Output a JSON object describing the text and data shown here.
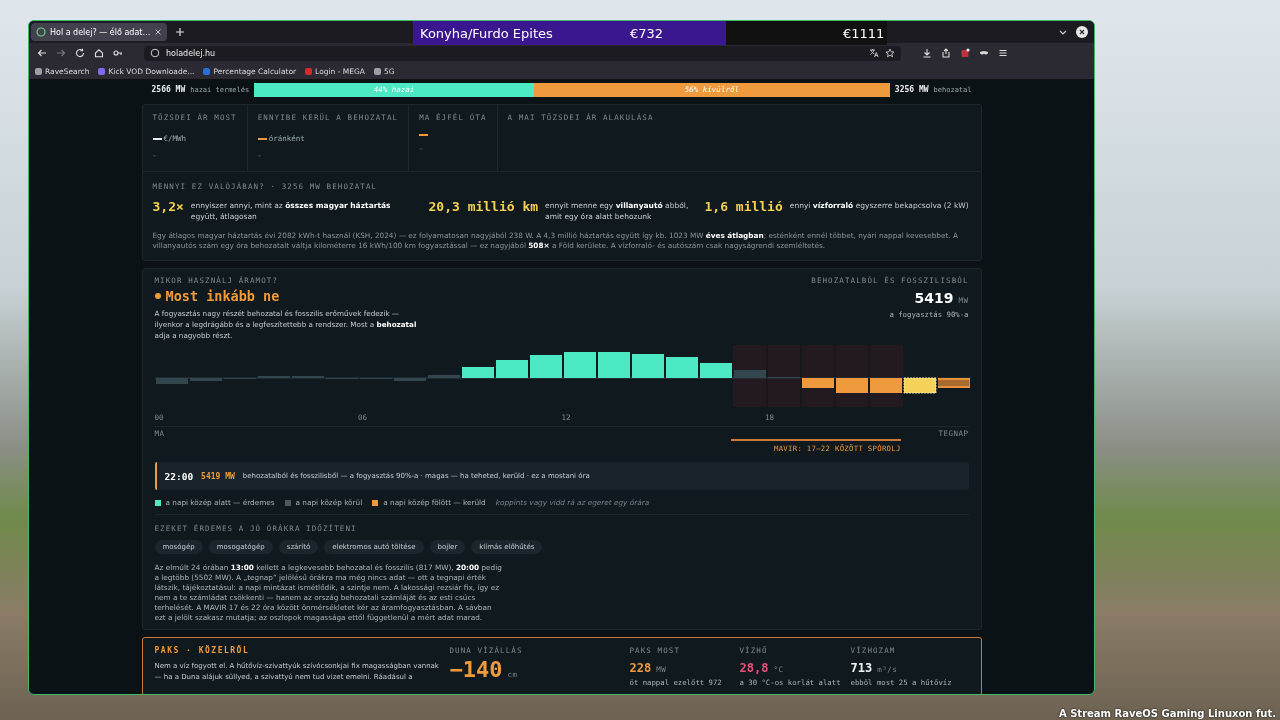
{
  "desktop": {
    "stream_ticker": "A Stream RaveOS Gaming Linuxon fut."
  },
  "goal_overlay": {
    "title": "Konyha/Furdo Epites",
    "current": "€732",
    "target": "€1111",
    "level": 0.66
  },
  "browser": {
    "tabs": [
      {
        "title": "Hol a delej? — élő adat…",
        "selected": true
      }
    ],
    "address": "holadelej.hu",
    "bookmarks": [
      {
        "label": "RaveSearch",
        "color": "#9aa0a6"
      },
      {
        "label": "Kick VOD Downloade...",
        "color": "#7b6cf0"
      },
      {
        "label": "Percentage Calculator",
        "color": "#2b6fd6"
      },
      {
        "label": "Login - MEGA",
        "color": "#d9272e"
      },
      {
        "label": "5G",
        "color": "#9aa0a6"
      }
    ]
  },
  "supply_bar": {
    "domestic_value": "2566 MW",
    "domestic_label": "hazai termelés",
    "domestic_share": "44% hazai",
    "import_share": "56% kívülről",
    "import_value": "3256 MW",
    "import_label": "behozatal",
    "level": 0.44
  },
  "prices": {
    "columns": [
      {
        "label": "TŐZSDEI ÁR MOST",
        "color": "#e8ecee",
        "unit": "€/MWh",
        "value": "–"
      },
      {
        "label": "ENNYIBE KERÜL A BEHOZATAL",
        "color": "#f09a3e",
        "unit": "óránként",
        "value": "–"
      },
      {
        "label": "MA ÉJFÉL ÓTA",
        "color": "#f09a3e",
        "value": "–"
      }
    ],
    "chart_title": "A MAI TŐZSDEI ÁR ALAKULÁSA"
  },
  "equivalents": {
    "title": "MENNYI EZ VALÓJÁBAN? · 3256 MW BEHOZATAL",
    "items": [
      {
        "value": "3,2×",
        "text": "ennyiszer annyi, mint az **összes magyar háztartás** együtt, átlagosan"
      },
      {
        "value": "20,3 millió km",
        "text": "ennyit menne egy **villanyautó** abból, amit egy óra alatt behozunk"
      },
      {
        "value": "1,6 millió",
        "text": "ennyi **vízforraló** egyszerre bekapcsolva (2 kW)"
      }
    ],
    "note": "Egy átlagos magyar háztartás évi 2082 kWh-t használ (KSH, 2024) — ez folyamatosan nagyjából 238 W. A 4,3 millió háztartás együtt így kb. 1023 MW **éves átlagban**; esténként ennél többet, nyári nappal kevesebbet. A villanyautós szám egy óra behozatalt váltja kilométerre 16 kWh/100 km fogyasztással — ez nagyjából **508×** a Föld kerülete. A vízforraló- és autószám csak nagyságrendi szemléltetés."
  },
  "timing": {
    "title": "MIKOR HASZNÁLJ ÁRAMOT?",
    "status": "Most inkább ne",
    "description": "A fogyasztás nagy részét behozatal és fosszilis erőművek fedezik — ilyenkor a legdrágább és a legfeszítettebb a rendszer. Most a **behozatal** adja a nagyobb részt.",
    "side_label": "BEHOZATALBÓL ÉS FOSSZILISBÓL",
    "side_value": "5419",
    "side_unit": "MW",
    "side_note": "a fogyasztás 90%-a",
    "hour_labels": [
      "00",
      "06",
      "12",
      "18"
    ],
    "today_label": "MA",
    "yesterday_label": "TEGNAP",
    "band_label": "MAVIR: 17–22 KÖZÖTT SPÓROLJ",
    "info": {
      "time": "22:00",
      "value": "5419 MW",
      "text": "behozatalból és fosszilisből — a fogyasztás 90%-a · magas — ha teheted, kerüld · ez a mostani óra"
    },
    "legend": [
      {
        "label": "a napi közép alatt — érdemes",
        "color": "#4de8c4"
      },
      {
        "label": "a napi közép körül",
        "color": "#4a5a62"
      },
      {
        "label": "a napi közép fölött — kerüld",
        "color": "#f09a3e"
      }
    ],
    "hint": "koppints vagy vidd rá az egeret egy órára",
    "appliances_title": "EZEKET ÉRDEMES A JÓ ÓRÁKRA IDŐZÍTENI",
    "appliances": [
      "mosógép",
      "mosogatógép",
      "szárító",
      "elektromos autó töltése",
      "bojler",
      "klímás előhűtés"
    ],
    "summary": "Az elmúlt 24 órában **13:00** kellett a legkevesebb behozatal és fosszilis (817 MW), **20:00** pedig a legtöbb (5502 MW). A „tegnap” jelölésű órákra ma még nincs adat — ott a tegnapi érték látszik, tájékoztatásul: a napi mintázat ismétlődik, a szintje nem. A lakossági rezsiár fix, így ez nem a te számládat csökkenti — hanem az ország behozatali számláját és az esti csúcs terhelését. A MAVIR 17 és 22 óra között önmérsékletet kér az áramfogyasztásban. A sávban ezt a jelölt szakasz mutatja; az oszlopok magassága ettől függetlenül a mért adat marad."
  },
  "paks": {
    "title": "PAKS · KÖZELRŐL",
    "text": "Nem a víz fogyott el. A hűtővíz-szivattyúk szívócsonkjai fix magasságban vannak — ha a Duna alájuk süllyed, a szivattyú nem tud vizet emelni. Ráadásul a",
    "level_label": "DUNA VÍZÁLLÁS",
    "level_value": "−140",
    "level_unit": "cm",
    "stats": [
      {
        "label": "PAKS MOST",
        "value": "228",
        "unit": "MW",
        "note": "öt nappal ezelőtt 972",
        "color": "#f09a3e"
      },
      {
        "label": "VÍZHŐ",
        "value": "28,8",
        "unit": "°C",
        "note": "a 30 °C-os korlát alatt",
        "color": "#ec4f7a"
      },
      {
        "label": "VÍZHOZAM",
        "value": "713",
        "unit": "m³/s",
        "note": "ebből most 25 a hűtővíz",
        "color": "#f2f4f5"
      }
    ]
  }
}
